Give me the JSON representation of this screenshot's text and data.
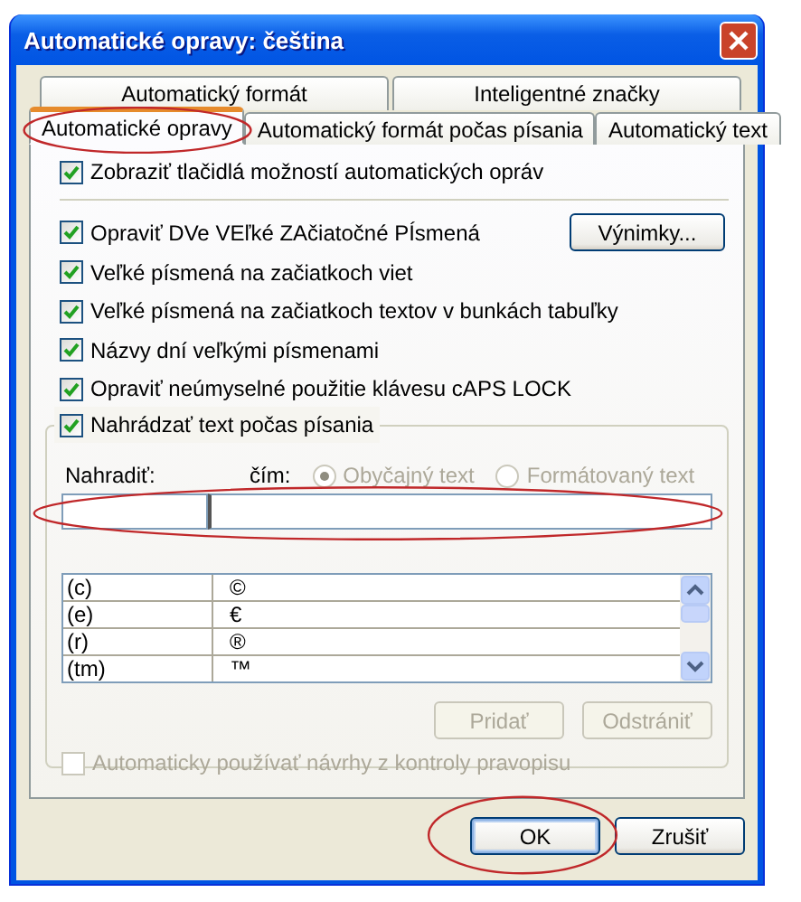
{
  "window": {
    "title": "Automatické opravy: čeština"
  },
  "tab_rows": [
    [
      {
        "label": "Automatický formát",
        "selected": false,
        "circled": false
      },
      {
        "label": "Inteligentné značky",
        "selected": false,
        "circled": false
      }
    ],
    [
      {
        "label": "Automatické opravy",
        "selected": true,
        "circled": true
      },
      {
        "label": "Automatický formát počas písania",
        "selected": false,
        "circled": false
      },
      {
        "label": "Automatický text",
        "selected": false,
        "circled": false
      }
    ]
  ],
  "show_buttons_option": {
    "label": "Zobraziť tlačidlá možností automatických opráv",
    "checked": true
  },
  "exceptions_button": {
    "label": "Výnimky..."
  },
  "options": [
    {
      "label": "Opraviť DVe VEľké ZAčiatočné PÍsmená",
      "checked": true
    },
    {
      "label": "Veľké písmená na začiatkoch viet",
      "checked": true
    },
    {
      "label": "Veľké písmená na začiatkoch textov v bunkách tabuľky",
      "checked": true
    },
    {
      "label": "Názvy dní veľkými písmenami",
      "checked": true
    },
    {
      "label": "Opraviť neúmyselné použitie klávesu cAPS LOCK",
      "checked": true
    }
  ],
  "replace_group": {
    "checkbox": {
      "label": "Nahrádzať text počas písania",
      "checked": true
    },
    "replace_label": "Nahradiť:",
    "with_label": "čím:",
    "format_options": [
      {
        "label": "Obyčajný text",
        "selected": true,
        "disabled": true
      },
      {
        "label": "Formátovaný text",
        "selected": false,
        "disabled": true
      }
    ],
    "fields_circled": true,
    "entries": [
      {
        "replace": "(c)",
        "with": "©"
      },
      {
        "replace": "(e)",
        "with": "€"
      },
      {
        "replace": "(r)",
        "with": "®"
      },
      {
        "replace": "(tm)",
        "with": "™"
      }
    ],
    "buttons": [
      {
        "label": "Pridať",
        "disabled": true
      },
      {
        "label": "Odstrániť",
        "disabled": true
      }
    ],
    "spelling_checkbox": {
      "label": "Automaticky používať návrhy z kontroly pravopisu",
      "checked": false,
      "disabled": true
    }
  },
  "buttons": [
    {
      "label": "OK",
      "default": true,
      "circled": true
    },
    {
      "label": "Zrušiť",
      "default": false,
      "circled": false
    }
  ]
}
